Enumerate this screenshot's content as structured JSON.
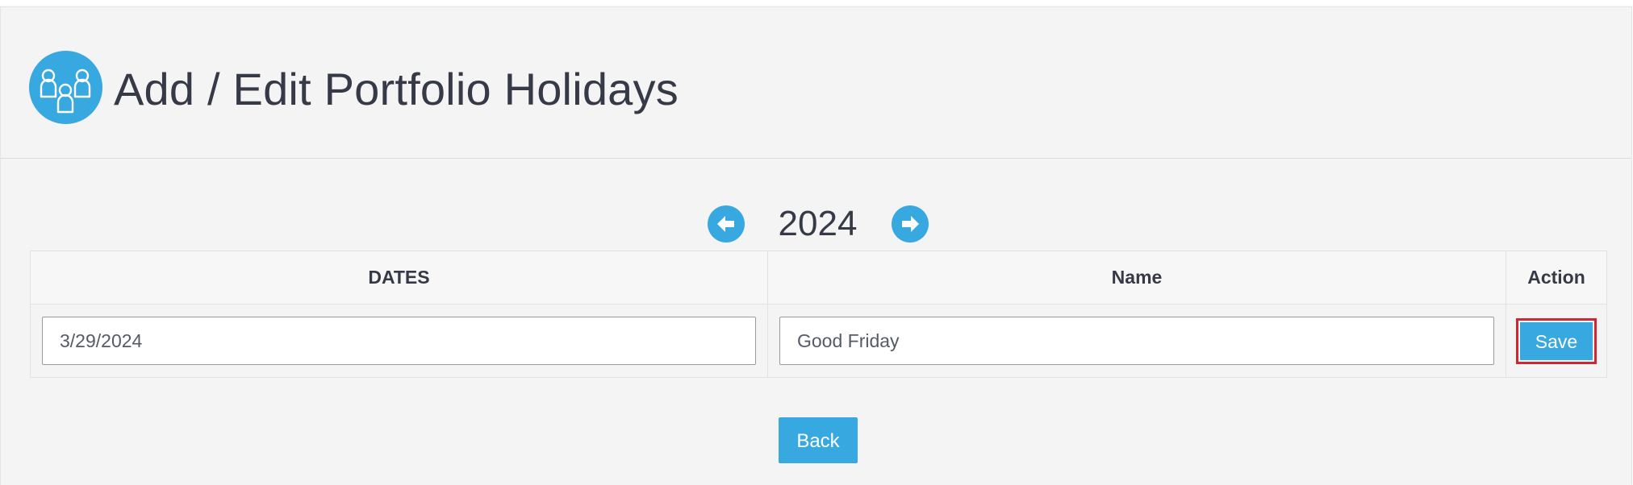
{
  "header": {
    "title": "Add / Edit Portfolio Holidays",
    "icon": "people-group-icon"
  },
  "year_nav": {
    "year": "2024",
    "prev_icon": "arrow-left-icon",
    "next_icon": "arrow-right-icon"
  },
  "table": {
    "columns": [
      "DATES",
      "Name",
      "Action"
    ],
    "rows": [
      {
        "date": "3/29/2024",
        "name": "Good Friday",
        "action_label": "Save"
      }
    ]
  },
  "footer": {
    "back_label": "Back"
  },
  "colors": {
    "accent": "#38a8e0",
    "highlight_border": "#d4242f",
    "panel_bg": "#f4f4f4",
    "text": "#363a46"
  }
}
